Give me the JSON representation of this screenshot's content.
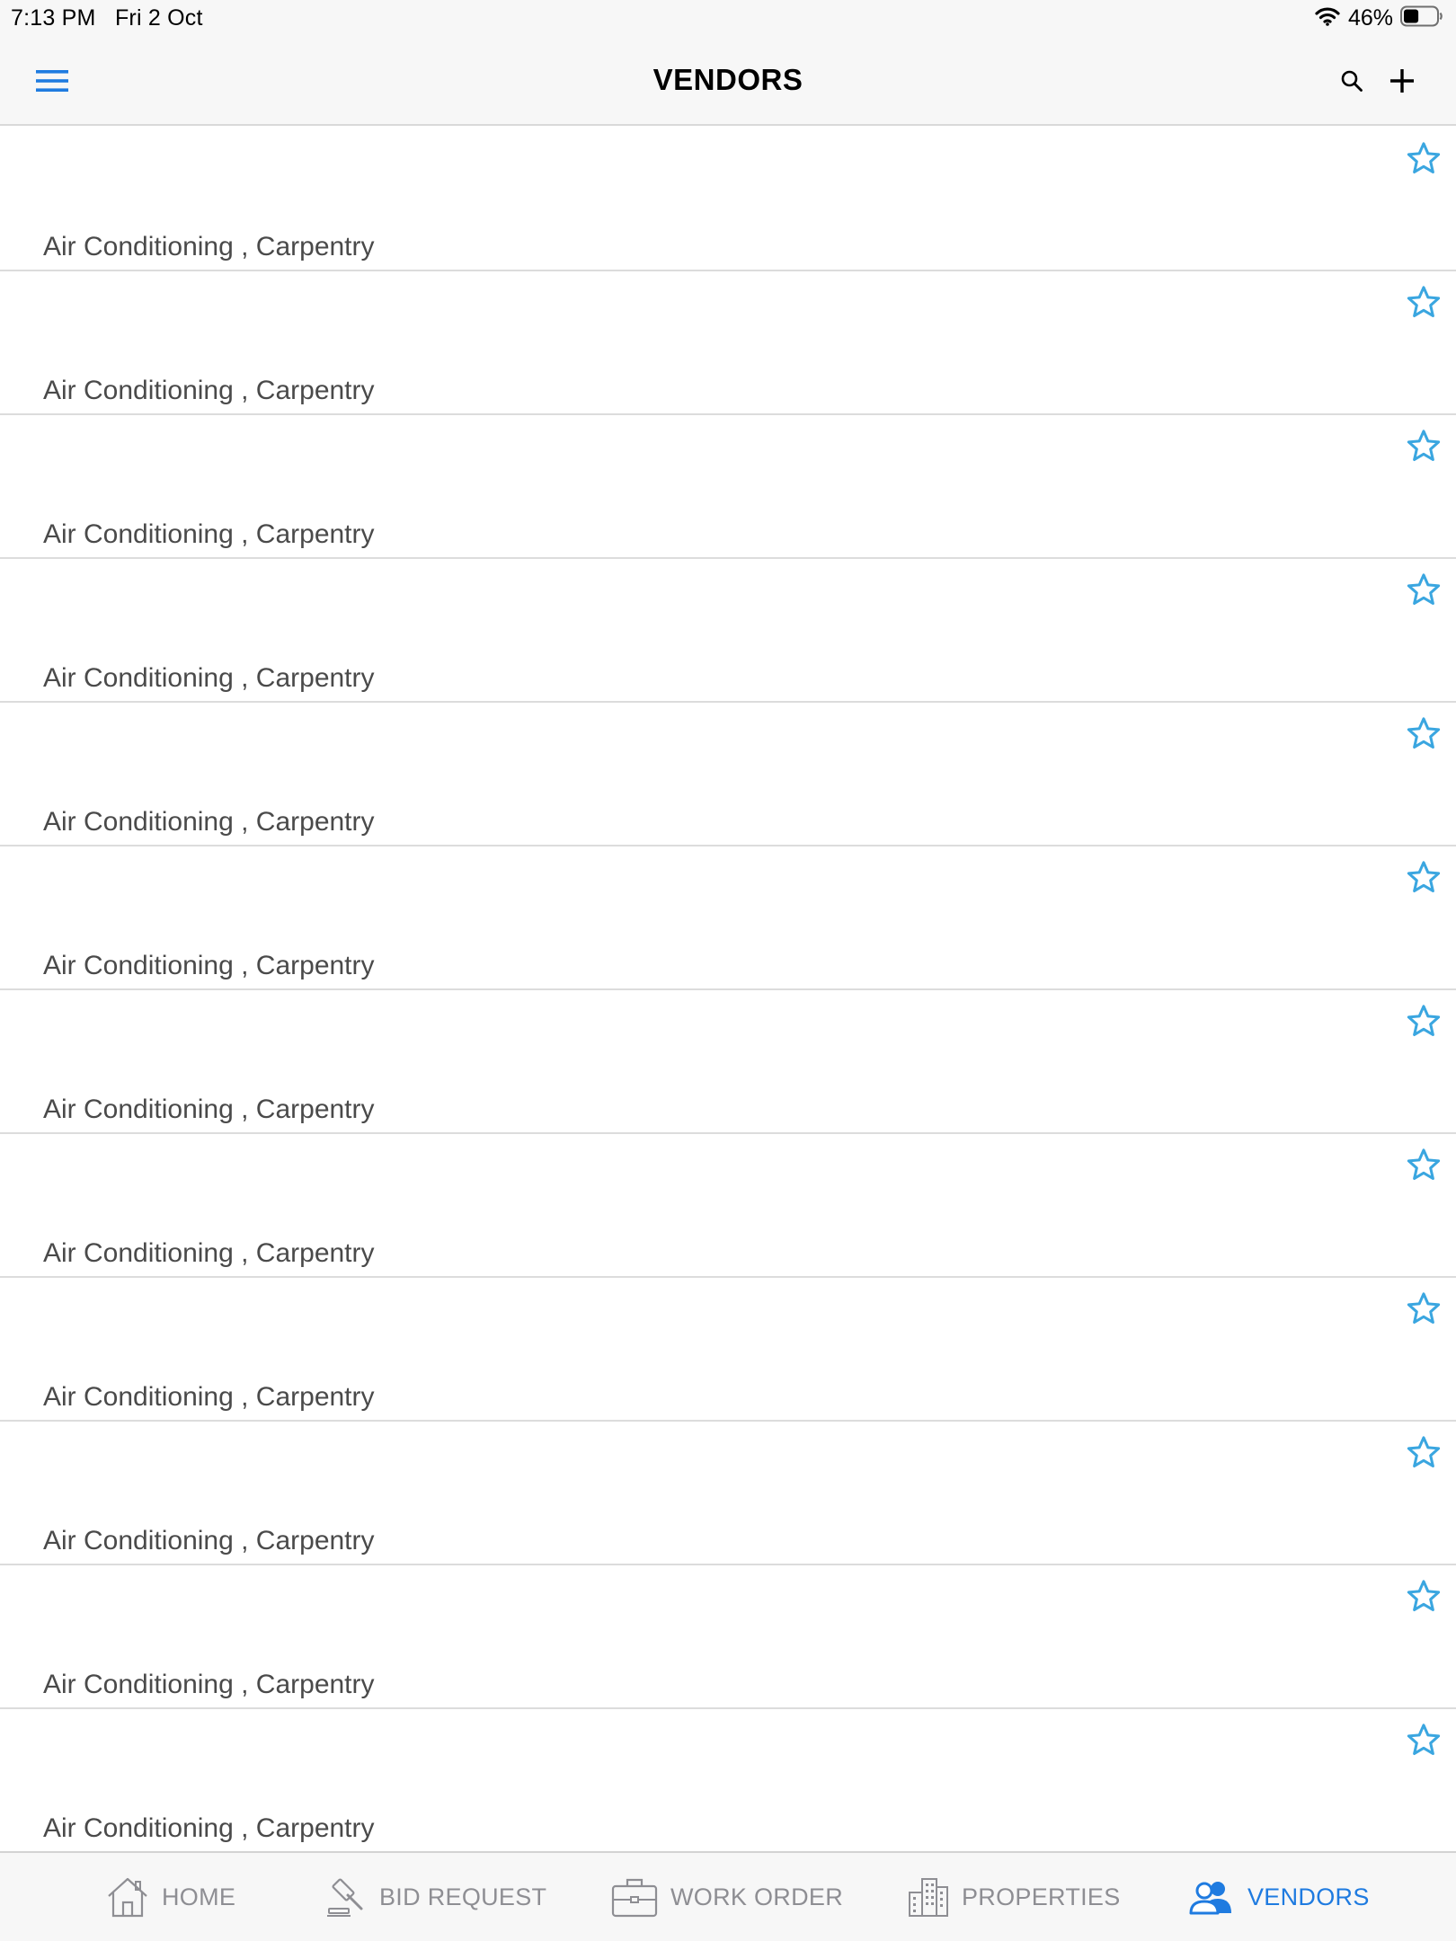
{
  "status_bar": {
    "time": "7:13 PM",
    "date": "Fri 2 Oct",
    "battery_percent": "46%",
    "battery_level": 0.46
  },
  "nav": {
    "title": "VENDORS",
    "menu_icon": "hamburger-menu-icon",
    "search_icon": "search-icon",
    "add_icon": "plus-icon"
  },
  "vendors": [
    {
      "categories": "Air Conditioning , Carpentry",
      "favorite": false
    },
    {
      "categories": "Air Conditioning , Carpentry",
      "favorite": false
    },
    {
      "categories": "Air Conditioning , Carpentry",
      "favorite": false
    },
    {
      "categories": "Air Conditioning , Carpentry",
      "favorite": false
    },
    {
      "categories": "Air Conditioning , Carpentry",
      "favorite": false
    },
    {
      "categories": "Air Conditioning , Carpentry",
      "favorite": false
    },
    {
      "categories": "Air Conditioning , Carpentry",
      "favorite": false
    },
    {
      "categories": "Air Conditioning , Carpentry",
      "favorite": false
    },
    {
      "categories": "Air Conditioning , Carpentry",
      "favorite": false
    },
    {
      "categories": "Air Conditioning , Carpentry",
      "favorite": false
    },
    {
      "categories": "Air Conditioning , Carpentry",
      "favorite": false
    },
    {
      "categories": "Air Conditioning , Carpentry",
      "favorite": false
    }
  ],
  "tab_bar": {
    "tabs": [
      {
        "label": "HOME",
        "icon": "home-icon",
        "active": false
      },
      {
        "label": "BID REQUEST",
        "icon": "gavel-icon",
        "active": false
      },
      {
        "label": "WORK ORDER",
        "icon": "briefcase-icon",
        "active": false
      },
      {
        "label": "PROPERTIES",
        "icon": "buildings-icon",
        "active": false
      },
      {
        "label": "VENDORS",
        "icon": "people-icon",
        "active": true
      }
    ]
  },
  "colors": {
    "accent": "#1f7be0",
    "star": "#3aa6e0",
    "inactive_tab": "#8e8e93",
    "bar_background": "#f7f7f7"
  }
}
